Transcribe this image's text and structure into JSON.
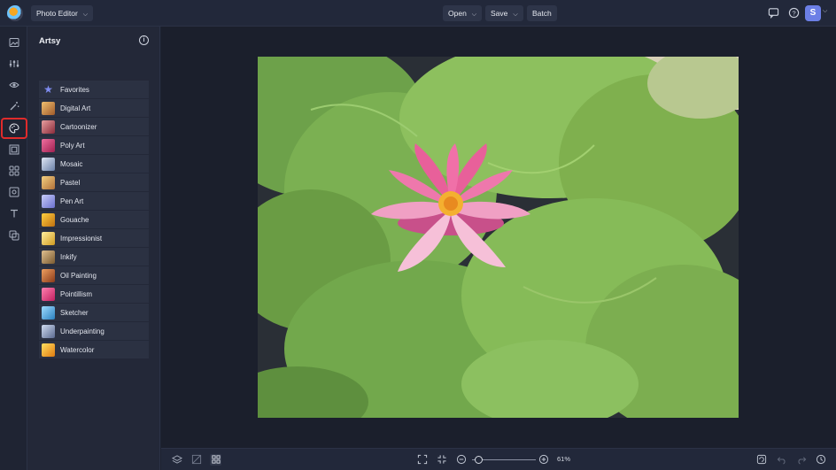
{
  "topbar": {
    "mode_label": "Photo Editor",
    "open_label": "Open",
    "save_label": "Save",
    "batch_label": "Batch",
    "avatar_initial": "S"
  },
  "rail": {
    "icons": [
      "image-icon",
      "adjustments-icon",
      "eye-icon",
      "magic-wand-icon",
      "artsy-palette-icon",
      "frame-icon",
      "graphics-icon",
      "textures-icon",
      "text-icon",
      "overlay-icon"
    ],
    "active_index": 4
  },
  "panel": {
    "title": "Artsy",
    "items": [
      {
        "label": "Favorites",
        "thumb": "#7f8cf0"
      },
      {
        "label": "Digital Art",
        "thumb": "#c07a3a"
      },
      {
        "label": "Cartoonizer",
        "thumb": "#b8505a"
      },
      {
        "label": "Poly Art",
        "thumb": "#d9487a"
      },
      {
        "label": "Mosaic",
        "thumb": "#8ca0c8"
      },
      {
        "label": "Pastel",
        "thumb": "#d8a04a"
      },
      {
        "label": "Pen Art",
        "thumb": "#9aa0e8"
      },
      {
        "label": "Gouache",
        "thumb": "#e0a020"
      },
      {
        "label": "Impressionist",
        "thumb": "#e8c44a"
      },
      {
        "label": "Inkify",
        "thumb": "#b08a5a"
      },
      {
        "label": "Oil Painting",
        "thumb": "#c46a3a"
      },
      {
        "label": "Pointillism",
        "thumb": "#e04a8a"
      },
      {
        "label": "Sketcher",
        "thumb": "#4aa8e0"
      },
      {
        "label": "Underpainting",
        "thumb": "#8a9ab8"
      },
      {
        "label": "Watercolor",
        "thumb": "#e8a020"
      }
    ]
  },
  "bottombar": {
    "zoom_label": "61%"
  }
}
